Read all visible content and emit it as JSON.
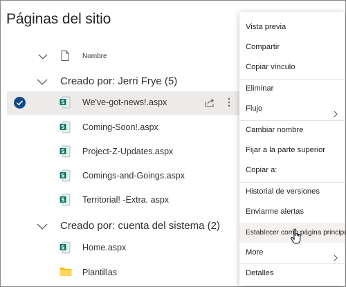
{
  "page": {
    "title": "Páginas del sitio"
  },
  "list": {
    "column_name": "Nombre",
    "groups": [
      {
        "title": "Creado por: Jerri Frye (5)",
        "rows": [
          {
            "name": "We've-got-news!.aspx",
            "selected": true
          },
          {
            "name": "Coming-Soon!.aspx"
          },
          {
            "name": "Project-Z-Updates.aspx"
          },
          {
            "name": "Comings-and-Goings.aspx"
          },
          {
            "name": "Territorial! -Extra. aspx"
          }
        ]
      },
      {
        "title": "Creado por: cuenta del sistema (2)",
        "rows": [
          {
            "name": "Home.aspx"
          },
          {
            "name": "Plantillas"
          }
        ]
      }
    ]
  },
  "menu": {
    "items": [
      {
        "label": "Vista previa"
      },
      {
        "label": "Compartir"
      },
      {
        "label": "Copiar vínculo"
      },
      {
        "label": "Eliminar"
      },
      {
        "label": "Flujo"
      },
      {
        "label": "Cambiar nombre"
      },
      {
        "label": "Fijar a la parte superior"
      },
      {
        "label": "Copiar a:"
      },
      {
        "label": "Historial de versiones"
      },
      {
        "label": "Enviarme alertas"
      },
      {
        "label": "Establecer como página principal"
      },
      {
        "label": "More"
      },
      {
        "label": "Detalles"
      }
    ]
  },
  "colors": {
    "accent": "#0f4a8a",
    "selected_row": "#edebe9",
    "sitepage_icon": "#077568",
    "folder_icon": "#ffb900"
  }
}
